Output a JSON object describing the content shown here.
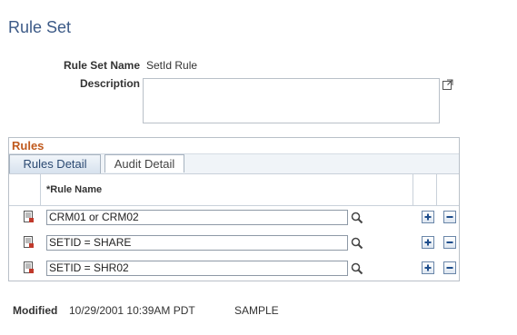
{
  "page": {
    "title": "Rule Set"
  },
  "form": {
    "rule_set_name_label": "Rule Set Name",
    "rule_set_name_value": "SetId Rule",
    "description_label": "Description",
    "description_value": ""
  },
  "grid": {
    "title": "Rules",
    "tabs": [
      {
        "label": "Rules Detail",
        "active": true
      },
      {
        "label": "Audit Detail",
        "active": false
      }
    ],
    "column_header": "*Rule Name",
    "rows": [
      {
        "rule_name": "CRM01 or CRM02"
      },
      {
        "rule_name": "SETID = SHARE"
      },
      {
        "rule_name": "SETID = SHR02"
      }
    ]
  },
  "footer": {
    "modified_label": "Modified",
    "modified_datetime": "10/29/2001 10:39AM PDT",
    "modified_by": "SAMPLE"
  },
  "icons": {
    "row_detail": "report-page-icon",
    "lookup": "magnifier-icon",
    "add": "plus-icon",
    "delete": "minus-icon",
    "expand": "expand-window-icon"
  },
  "colors": {
    "title": "#3c5a87",
    "grid_title": "#c05a1e",
    "tab_active": "#d7e2ee",
    "border": "#b9c0c8",
    "button_icon": "#1f4e8c"
  }
}
